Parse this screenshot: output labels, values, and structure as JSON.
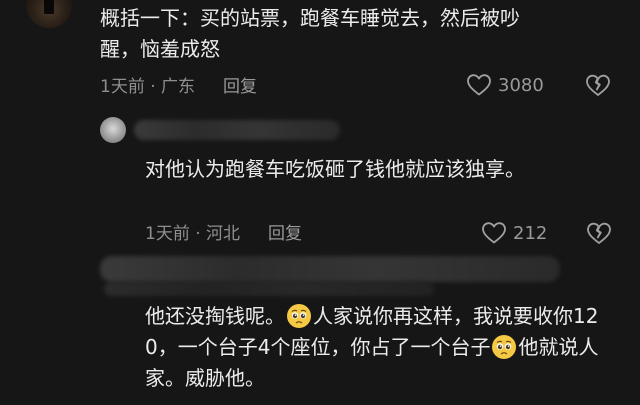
{
  "comments": [
    {
      "text": "概括一下：买的站票，跑餐车睡觉去，然后被吵醒，恼羞成怒",
      "date": "1天前",
      "location": "广东",
      "reply_label": "回复",
      "likes": "3080"
    },
    {
      "text": "对他认为跑餐车吃饭砸了钱他就应该独享。",
      "date": "1天前",
      "location": "河北",
      "reply_label": "回复",
      "likes": "212"
    },
    {
      "text_part1": "他还没掏钱呢。",
      "text_part2": "人家说你再这样，我说要收你120，一个台子4个座位，你占了一个台子",
      "text_part3": "他就说人家。威胁他。"
    }
  ],
  "icons": {
    "like": "heart-outline-icon",
    "dislike": "broken-heart-icon",
    "emoji": "pleading-face-emoji"
  },
  "colors": {
    "background": "#161616",
    "text": "#ececec",
    "meta": "#8f8f8f"
  }
}
